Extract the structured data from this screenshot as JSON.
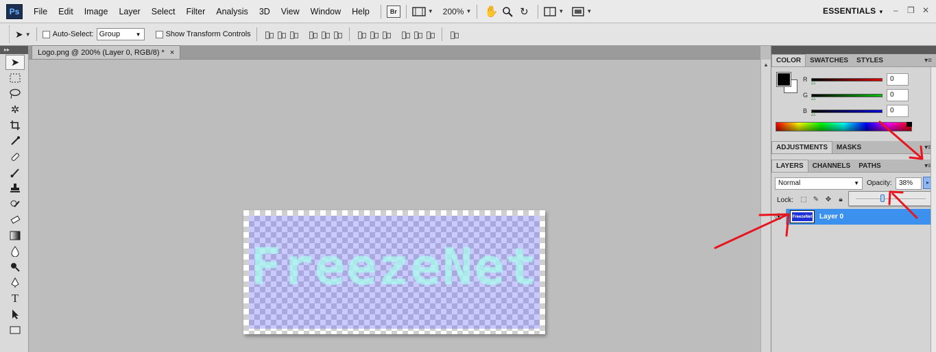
{
  "app": {
    "logo": "Ps",
    "workspace": "ESSENTIALS"
  },
  "menu": [
    "File",
    "Edit",
    "Image",
    "Layer",
    "Select",
    "Filter",
    "Analysis",
    "3D",
    "View",
    "Window",
    "Help"
  ],
  "menubar": {
    "bridge_label": "Br",
    "zoom": "200%"
  },
  "options": {
    "auto_select_label": "Auto-Select:",
    "auto_select_value": "Group",
    "show_transform_label": "Show Transform Controls"
  },
  "document": {
    "tab_title": "Logo.png @ 200% (Layer 0, RGB/8) *",
    "close": "×",
    "canvas_text": "FreezeNet"
  },
  "color_panel": {
    "tabs": [
      "COLOR",
      "SWATCHES",
      "STYLES"
    ],
    "r_label": "R",
    "g_label": "G",
    "b_label": "B",
    "r_value": "0",
    "g_value": "0",
    "b_value": "0",
    "colors": {
      "r": "#e00000",
      "g": "#00c000",
      "b": "#0000e0"
    }
  },
  "adjustments_panel": {
    "tabs": [
      "ADJUSTMENTS",
      "MASKS"
    ]
  },
  "layers_panel": {
    "tabs": [
      "LAYERS",
      "CHANNELS",
      "PATHS"
    ],
    "blend_mode": "Normal",
    "opacity_label": "Opacity:",
    "opacity_value": "38%",
    "opacity_fraction": 0.38,
    "lock_label": "Lock:",
    "layer_name": "Layer 0",
    "layer_thumb_text": "FreezeNet"
  },
  "accent_colors": {
    "selection": "#3d91ee",
    "annotation": "#e8141e"
  }
}
